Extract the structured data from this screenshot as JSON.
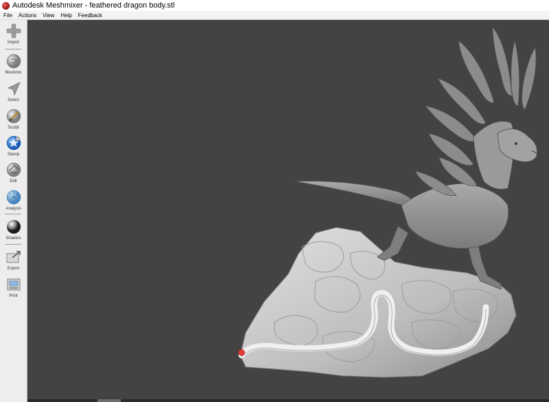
{
  "window": {
    "title": "Autodesk Meshmixer - feathered dragon body.stl",
    "icon": "meshmixer-icon"
  },
  "menu": [
    "File",
    "Actions",
    "View",
    "Help",
    "Feedback"
  ],
  "tools": [
    {
      "label": "Import",
      "icon": "plus-icon"
    },
    {
      "label": "Meshmix",
      "icon": "meshmix-icon"
    },
    {
      "label": "Select",
      "icon": "arrow-cursor-icon"
    },
    {
      "label": "Sculpt",
      "icon": "brush-icon"
    },
    {
      "label": "Stamp",
      "icon": "stamp-icon"
    },
    {
      "label": "Edit",
      "icon": "edit-icon"
    },
    {
      "label": "Analysis",
      "icon": "analysis-icon"
    },
    {
      "label": "Shaders",
      "icon": "sphere-icon"
    },
    {
      "label": "Export",
      "icon": "export-icon"
    },
    {
      "label": "Print",
      "icon": "printer-icon"
    }
  ],
  "colors": {
    "viewport_bg": "#434343",
    "mesh": "#c8c8c8",
    "pivot_marker": "#e53935"
  }
}
